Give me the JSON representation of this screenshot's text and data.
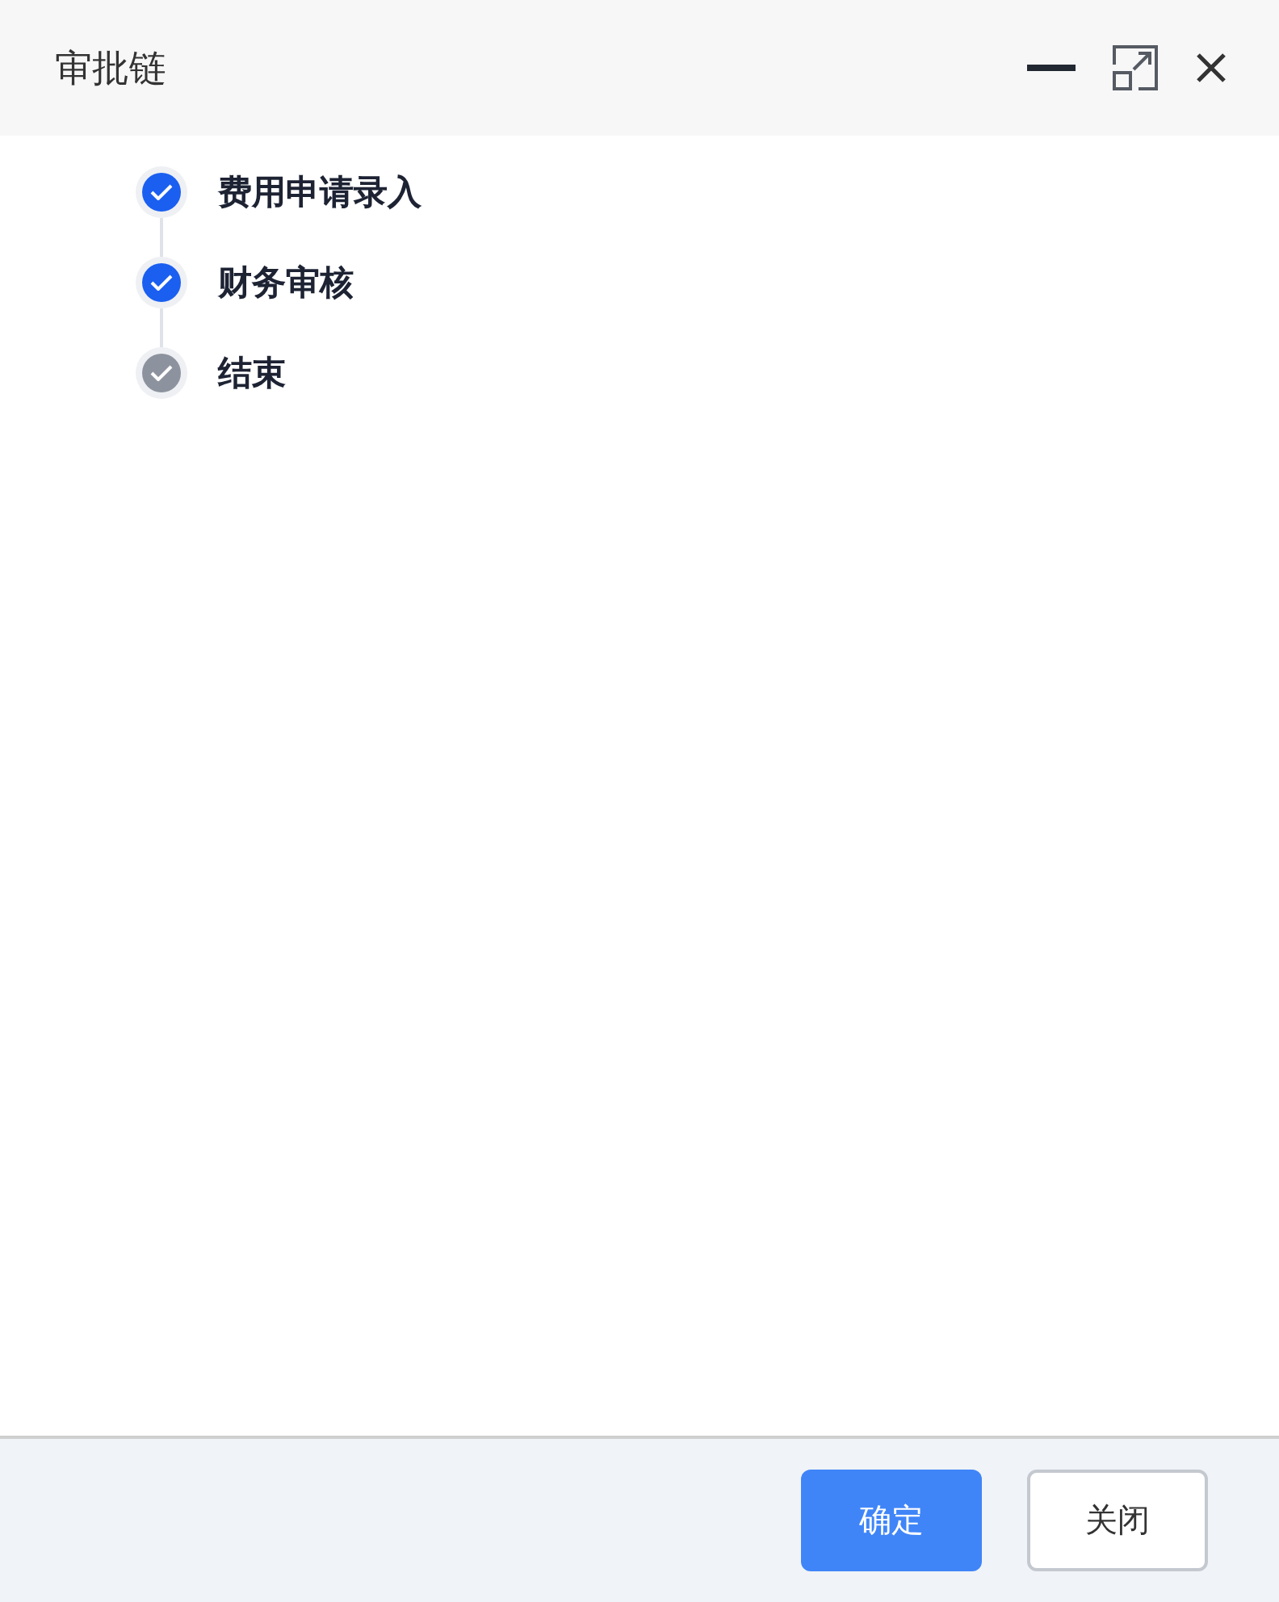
{
  "window": {
    "title": "审批链"
  },
  "steps": [
    {
      "label": "费用申请录入",
      "kind": "done"
    },
    {
      "label": "财务审核",
      "kind": "done"
    },
    {
      "label": "结束",
      "kind": "end"
    }
  ],
  "buttons": [
    {
      "label": "确定",
      "kind": "primary"
    },
    {
      "label": "关闭",
      "kind": "secondary"
    }
  ]
}
